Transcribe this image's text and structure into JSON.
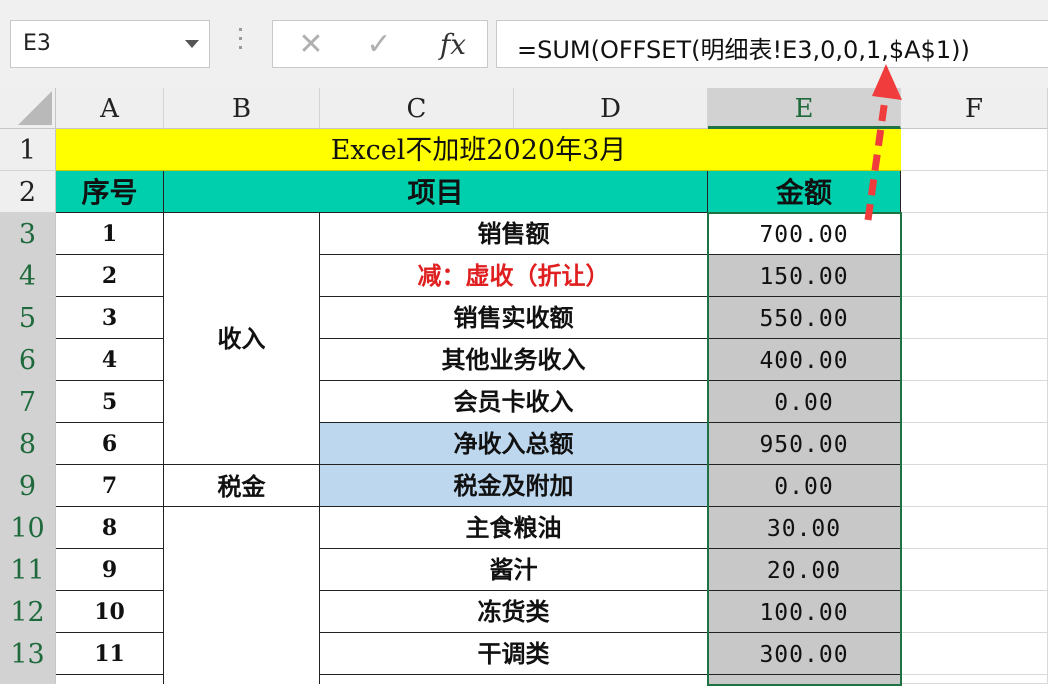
{
  "name_box": {
    "value": "E3"
  },
  "formula_bar": {
    "cancel_glyph": "✕",
    "enter_glyph": "✓",
    "fx_label": "fx",
    "formula": "=SUM(OFFSET(明细表!E3,0,0,1,$A$1))"
  },
  "columns": [
    "A",
    "B",
    "C",
    "D",
    "E",
    "F"
  ],
  "rows": [
    "1",
    "2",
    "3",
    "4",
    "5",
    "6",
    "7",
    "8",
    "9",
    "10",
    "11",
    "12",
    "13"
  ],
  "sheet": {
    "title": "Excel不加班2020年3月",
    "header": {
      "seq": "序号",
      "item": "项目",
      "amount": "金额"
    },
    "groups": {
      "income": "收入",
      "tax": "税金"
    },
    "items": [
      {
        "seq": "1",
        "item": "销售额",
        "amount": "700.00"
      },
      {
        "seq": "2",
        "item": "减：虚收（折让）",
        "amount": "150.00"
      },
      {
        "seq": "3",
        "item": "销售实收额",
        "amount": "550.00"
      },
      {
        "seq": "4",
        "item": "其他业务收入",
        "amount": "400.00"
      },
      {
        "seq": "5",
        "item": "会员卡收入",
        "amount": "0.00"
      },
      {
        "seq": "6",
        "item": "净收入总额",
        "amount": "950.00"
      },
      {
        "seq": "7",
        "item": "税金及附加",
        "amount": "0.00"
      },
      {
        "seq": "8",
        "item": "主食粮油",
        "amount": "30.00"
      },
      {
        "seq": "9",
        "item": "酱汁",
        "amount": "20.00"
      },
      {
        "seq": "10",
        "item": "冻货类",
        "amount": "100.00"
      },
      {
        "seq": "11",
        "item": "干调类",
        "amount": "300.00"
      }
    ]
  },
  "colors": {
    "title_fill": "#ffff00",
    "header_fill": "#00cfae",
    "highlight_fill": "#bdd7ee",
    "selected_fill": "#c8c8c8",
    "arrow": "#f03c3c",
    "accent_text": "#e02020"
  }
}
